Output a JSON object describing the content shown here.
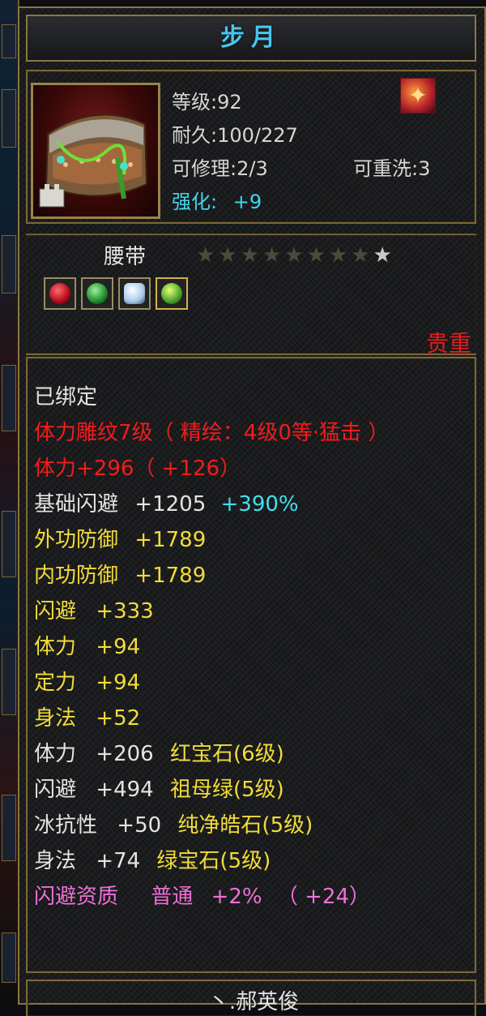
{
  "item": {
    "name": "步月",
    "type": "腰带",
    "stats": {
      "level": "等级:92",
      "durability": "耐久:100/227",
      "repair": "可修理:2/3",
      "rewash": "可重洗:3",
      "enhance_label": "强化:",
      "enhance_value": "+9"
    },
    "stars": {
      "filled": 8,
      "total": 9
    },
    "sockets": [
      "red-gem",
      "green-gem",
      "white-gem",
      "emerald-gem"
    ],
    "quality": "贵重",
    "colors": {
      "title": "#47c6ee",
      "quality": "#e61c1c"
    }
  },
  "attributes": {
    "bound": "已绑定",
    "engrave": "体力雕纹7级（ 精绘：4级0等·猛击 ）",
    "stamina_main": "体力+296（ +126）",
    "base_dodge": {
      "label": "基础闪避",
      "value": "+1205",
      "pct": "+390%"
    },
    "ext_def": {
      "label": "外功防御",
      "value": "+1789"
    },
    "int_def": {
      "label": "内功防御",
      "value": "+1789"
    },
    "dodge": {
      "label": "闪避",
      "value": "+333"
    },
    "stamina": {
      "label": "体力",
      "value": "+94"
    },
    "focus": {
      "label": "定力",
      "value": "+94"
    },
    "agility": {
      "label": "身法",
      "value": "+52"
    },
    "gem_lines": [
      {
        "label": "体力",
        "value": "+206",
        "gem": "红宝石(6级)"
      },
      {
        "label": "闪避",
        "value": "+494",
        "gem": "祖母绿(5级)"
      },
      {
        "label": "冰抗性",
        "value": "+50",
        "gem": "纯净皓石(5级)"
      },
      {
        "label": "身法",
        "value": "+74",
        "gem": "绿宝石(5级)"
      }
    ],
    "aptitude": {
      "label": "闪避资质",
      "grade": "普通",
      "value": "+2%",
      "extra": "（ +24）"
    }
  },
  "footer": {
    "maker": "丶.郝英俊"
  }
}
